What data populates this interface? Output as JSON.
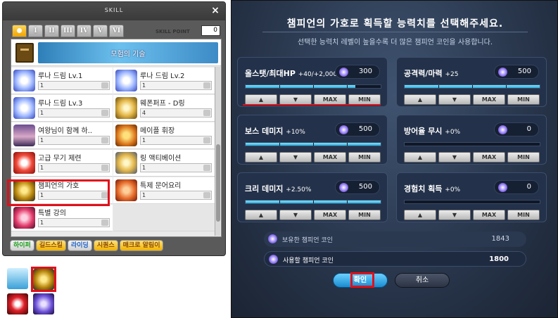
{
  "skill_window": {
    "title": "SKILL",
    "close_glyph": "×",
    "tabs": [
      "",
      "I",
      "II",
      "III",
      "IV",
      "V",
      "VI"
    ],
    "skill_point_label": "SKILL POINT",
    "skill_point_value": "0",
    "category_name": "모험의 기술",
    "skills": [
      {
        "name": "루나 드림 Lv.1",
        "level": "1",
        "icon": "luna-dream-icon"
      },
      {
        "name": "루나 드림 Lv.2",
        "level": "1",
        "icon": "luna-dream-icon"
      },
      {
        "name": "루나 드림 Lv.3",
        "level": "1",
        "icon": "luna-dream-icon"
      },
      {
        "name": "웨폰퍼프 - D링",
        "level": "4",
        "icon": "weapon-puff-ring-icon"
      },
      {
        "name": "여왕님이 함께 하..",
        "level": "1",
        "icon": "queen-portrait-icon"
      },
      {
        "name": "메이플 휘장",
        "level": "1",
        "icon": "maple-emblem-icon"
      },
      {
        "name": "고급 무기 제련",
        "level": "1",
        "icon": "weapon-refine-icon"
      },
      {
        "name": "링 액티베이션",
        "level": "1",
        "icon": "ring-activation-icon"
      },
      {
        "name": "챔피언의 가호",
        "level": "1",
        "icon": "champion-blessing-icon"
      },
      {
        "name": "특제 문어요리",
        "level": "1",
        "icon": "octopus-dish-icon"
      },
      {
        "name": "특별 강의",
        "level": "1",
        "icon": "special-lecture-icon"
      }
    ],
    "bottom_tabs": [
      {
        "label": "하이퍼",
        "style": "green"
      },
      {
        "label": "길드스킬",
        "style": "orange"
      },
      {
        "label": "라이딩",
        "style": "blue"
      },
      {
        "label": "시퀀스",
        "style": "orange"
      },
      {
        "label": "매크로 알림이",
        "style": "orange"
      }
    ]
  },
  "champion_dialog": {
    "title": "챔피언의 가호로 획득할 능력치를 선택해주세요.",
    "subtitle": "선택한 능력치 레벨이 높을수록 더 많은 챔피언 코인을 사용합니다.",
    "stats": [
      {
        "label": "올스탯/최대HP",
        "bonus": "+40/+2,000",
        "cost": "300",
        "fill": 0.81
      },
      {
        "label": "공격력/마력",
        "bonus": "+25",
        "cost": "500",
        "fill": 1.0
      },
      {
        "label": "보스 데미지",
        "bonus": "+10%",
        "cost": "500",
        "fill": 1.0
      },
      {
        "label": "방어율 무시",
        "bonus": "+0%",
        "cost": "0",
        "fill": 0.0
      },
      {
        "label": "크리 데미지",
        "bonus": "+2.50%",
        "cost": "500",
        "fill": 1.0
      },
      {
        "label": "경험치 획득",
        "bonus": "+0%",
        "cost": "0",
        "fill": 0.0
      }
    ],
    "buttons": {
      "up": "▲",
      "down": "▼",
      "max": "MAX",
      "min": "MIN"
    },
    "owned_coin_label": "보유한 챔피언 코인",
    "owned_coin_value": "1843",
    "use_coin_label": "사용할 챔피언 코인",
    "use_coin_value": "1800",
    "ok_label": "확인",
    "cancel_label": "취소"
  }
}
